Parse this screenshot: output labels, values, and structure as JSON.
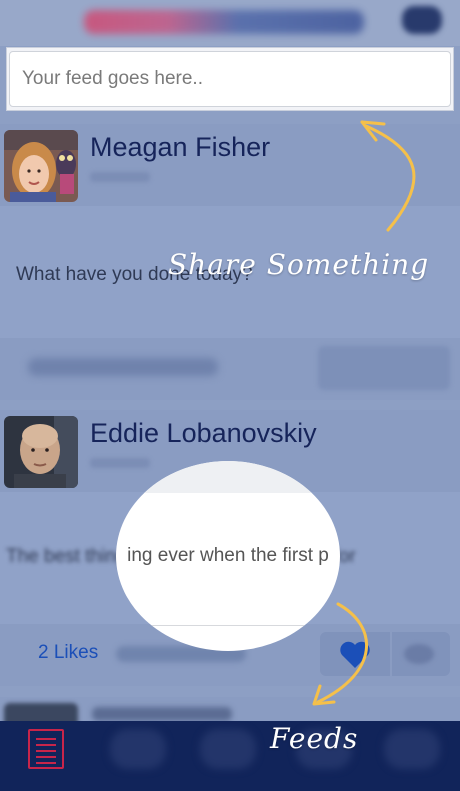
{
  "feed_input": {
    "placeholder": "Your feed goes here.."
  },
  "posts": [
    {
      "author": "Meagan Fisher",
      "text": "What have you done today?",
      "avatar_icon": "woman-with-plush-toy-avatar"
    },
    {
      "author": "Eddie Lobanovskiy",
      "text": "The best thing ever when the first post for",
      "spotlight_text": "ing ever when the first p",
      "likes": "2 Likes",
      "avatar_icon": "bald-man-avatar"
    }
  ],
  "annotations": {
    "share": "Share Something",
    "feeds": "Feeds"
  },
  "colors": {
    "overlay": "#8d9fc4",
    "nav_bg": "#11245a",
    "accent_red": "#c8254a",
    "like_blue": "#1b4fb8",
    "arrow_yellow": "#f5c04a"
  },
  "icons": {
    "menu": "menu-list-icon",
    "like": "heart-icon",
    "comment": "comment-bubble-icon"
  }
}
